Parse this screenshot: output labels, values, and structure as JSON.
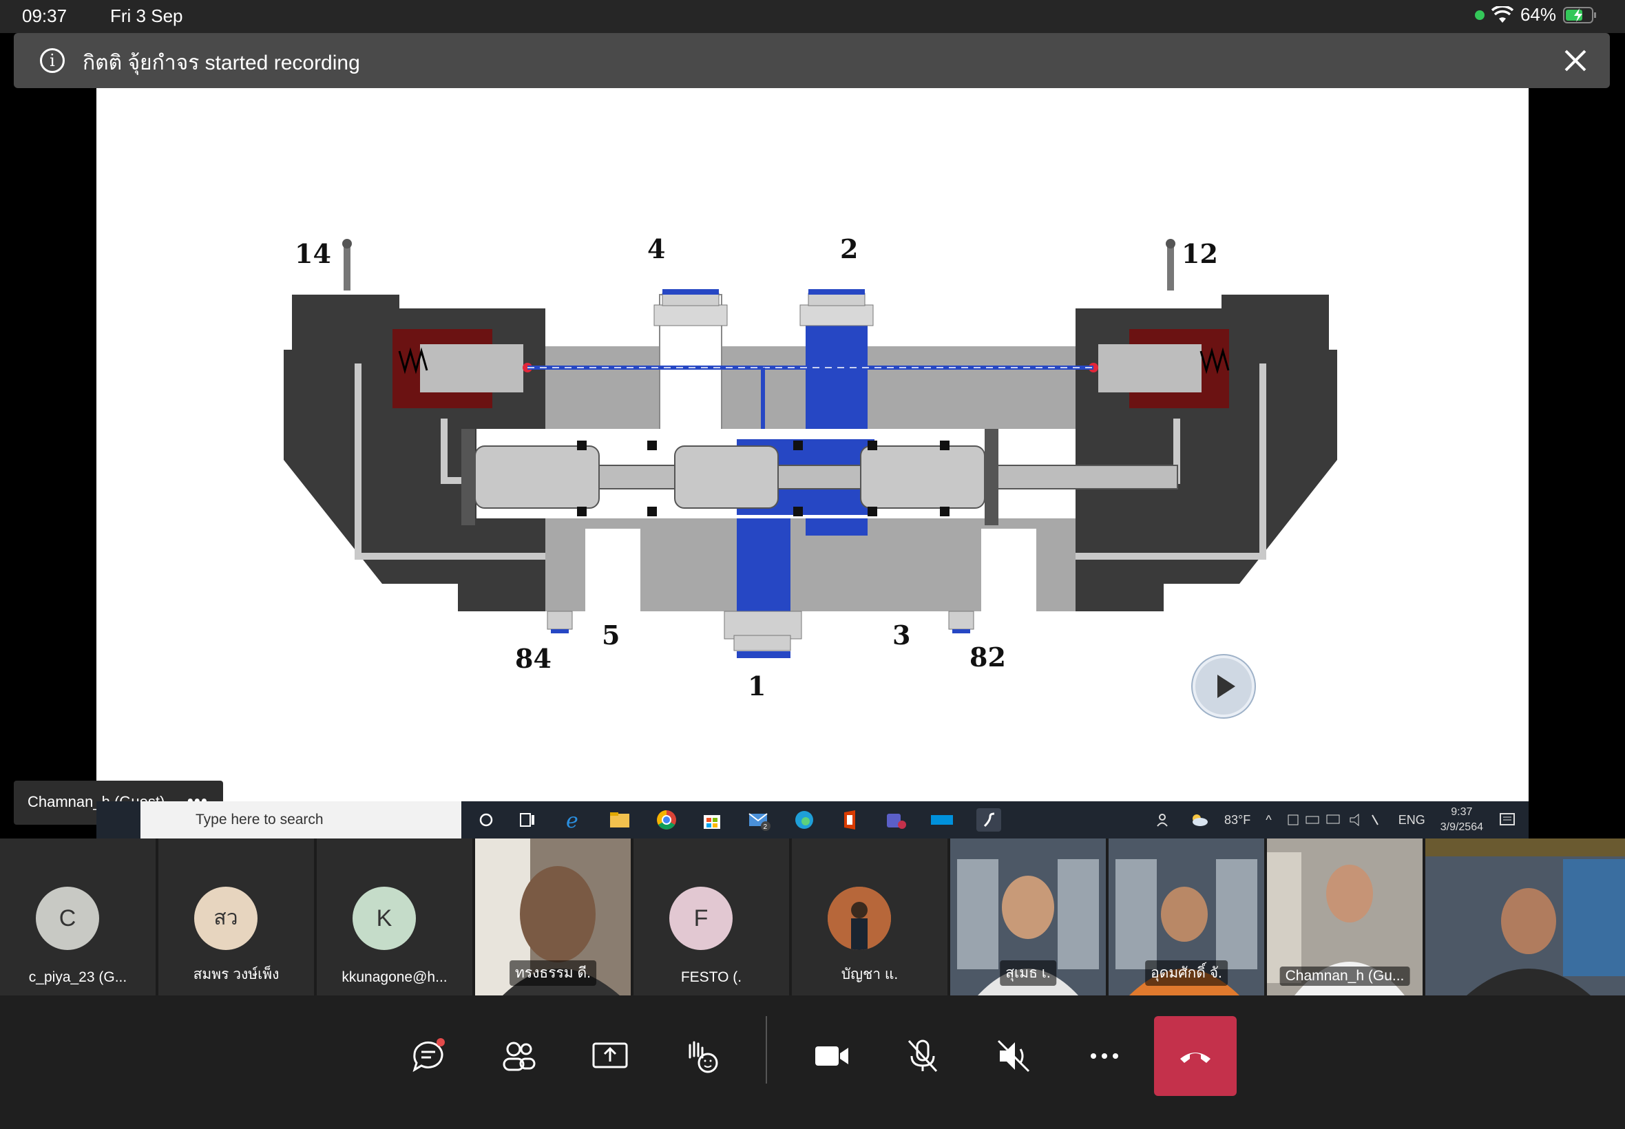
{
  "status_bar": {
    "time": "09:37",
    "date": "Fri 3 Sep",
    "battery": "64%"
  },
  "banner": {
    "message": "กิตติ จุ้ยกำจร started recording"
  },
  "diagram": {
    "port_labels": [
      "14",
      "4",
      "2",
      "12",
      "84",
      "5",
      "1",
      "3",
      "82"
    ]
  },
  "presenter": {
    "label": "Chamnan_h (Guest)"
  },
  "taskbar": {
    "search_placeholder": "Type here to search",
    "weather": "83°F",
    "language": "ENG",
    "clock_time": "9:37",
    "clock_date": "3/9/2564",
    "mail_badge": "2"
  },
  "participants": [
    {
      "initials": "C",
      "name": "c_piya_23 (G...",
      "color": "#c8c9c4",
      "type": "avatar"
    },
    {
      "initials": "สว",
      "name": "สมพร  วงษ์เพ็ง",
      "color": "#e7d5bf",
      "type": "avatar"
    },
    {
      "initials": "K",
      "name": "kkunagone@h...",
      "color": "#c5dcc9",
      "type": "avatar"
    },
    {
      "initials": "",
      "name": "ทรงธรรม ดี.",
      "color": "#6b5a4c",
      "type": "video"
    },
    {
      "initials": "F",
      "name": "FESTO (.",
      "color": "#e2c8d2",
      "type": "avatar"
    },
    {
      "initials": "",
      "name": "บัญชา แ.",
      "color": "#7a5a3a",
      "type": "photo"
    },
    {
      "initials": "",
      "name": "สุเมธ เ.",
      "color": "#5a6470",
      "type": "video"
    },
    {
      "initials": "",
      "name": "อุดมศักดิ์ จั.",
      "color": "#5a6470",
      "type": "video"
    },
    {
      "initials": "",
      "name": "Chamnan_h (Gu...",
      "color": "#8a8a84",
      "type": "video"
    },
    {
      "initials": "",
      "name": "",
      "color": "#55606c",
      "type": "video"
    }
  ],
  "controls": [
    "chat",
    "people",
    "share",
    "react",
    "camera",
    "mic-off",
    "speaker-off",
    "more",
    "hang-up"
  ],
  "colors": {
    "hangup": "#c4314b",
    "banner": "#4a4a4a",
    "valve_blue": "#2647c4",
    "valve_dark": "#3a3a3a"
  }
}
